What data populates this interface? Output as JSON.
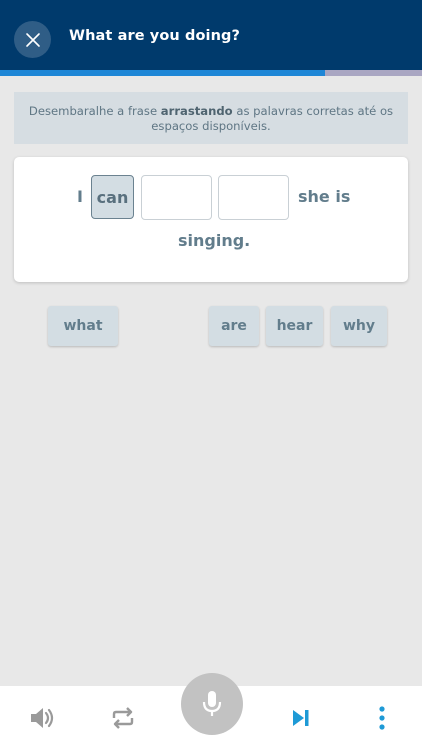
{
  "header": {
    "title": "What are you doing?",
    "close_icon": "close-icon",
    "background": "#003a6c"
  },
  "progress": {
    "fraction": 0.77,
    "fill_color": "#1e86d6",
    "track_color": "#a9a6c2"
  },
  "instruction": {
    "text_before": "Desembaralhe a frase ",
    "text_bold": "arrastando",
    "text_after": " as palavras corretas até os espaços disponíveis."
  },
  "sentence": {
    "word_1": "I",
    "slot_1": "can",
    "word_2": "she is",
    "word_3": "singing."
  },
  "word_bank": [
    "what",
    "are",
    "hear",
    "why"
  ],
  "toolbar": {
    "icons": [
      "speaker-icon",
      "repeat-icon",
      "microphone-icon",
      "skip-icon",
      "more-vertical-icon"
    ],
    "accent": "#1e9ad6"
  }
}
